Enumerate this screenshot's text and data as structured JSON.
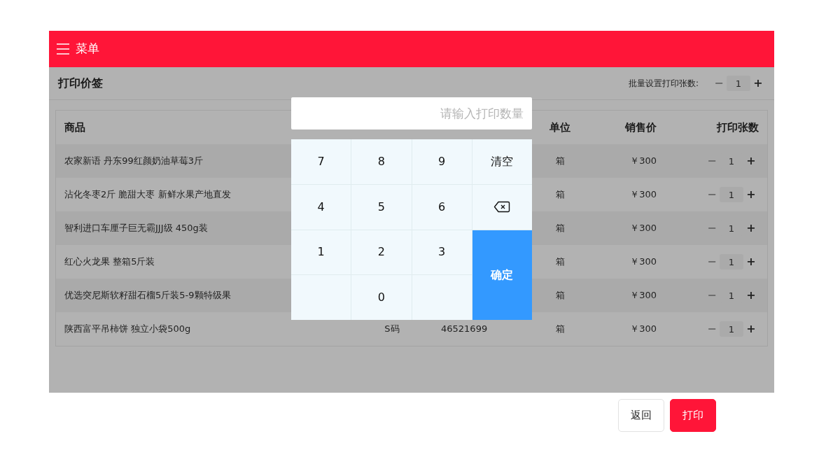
{
  "menu": {
    "label": "菜单"
  },
  "page_title": "打印价签",
  "batch": {
    "label": "批量设置打印张数:",
    "minus": "−",
    "value": "1",
    "plus": "+"
  },
  "table": {
    "columns": [
      {
        "kind": "name",
        "label": "商品"
      },
      {
        "kind": "unit",
        "label": "单位"
      },
      {
        "kind": "price",
        "label": "销售价"
      },
      {
        "kind": "qty",
        "label": "打印张数"
      }
    ],
    "rows": [
      {
        "name": "农家新语 丹东99红颜奶油草莓3斤",
        "unit": "箱",
        "price": "￥300",
        "minus": "−",
        "qty": "1",
        "plus": "+"
      },
      {
        "name": "沾化冬枣2斤 脆甜大枣 新鲜水果产地直发",
        "unit": "箱",
        "price": "￥300",
        "minus": "−",
        "qty": "1",
        "plus": "+"
      },
      {
        "name": "智利进口车厘子巨无霸JJJ级 450g装",
        "unit": "箱",
        "price": "￥300",
        "minus": "−",
        "qty": "1",
        "plus": "+"
      },
      {
        "name": "红心火龙果 整箱5斤装",
        "unit": "箱",
        "price": "￥300",
        "minus": "−",
        "qty": "1",
        "plus": "+"
      },
      {
        "name": "优选突尼斯软籽甜石榴5斤装5-9颗特级果",
        "unit": "箱",
        "price": "￥300",
        "minus": "−",
        "qty": "1",
        "plus": "+"
      },
      {
        "name": "陕西富平吊柿饼 独立小袋500g",
        "spec": "S码",
        "barcode": "46521699",
        "unit": "箱",
        "price": "￥300",
        "minus": "−",
        "qty": "1",
        "plus": "+"
      }
    ]
  },
  "keypad": {
    "placeholder": "请输入打印数量",
    "keys": [
      {
        "kind": "digit",
        "label": "7"
      },
      {
        "kind": "digit",
        "label": "8"
      },
      {
        "kind": "digit",
        "label": "9"
      },
      {
        "kind": "clear",
        "label": "清空"
      },
      {
        "kind": "digit",
        "label": "4"
      },
      {
        "kind": "digit",
        "label": "5"
      },
      {
        "kind": "digit",
        "label": "6"
      },
      {
        "kind": "backspace"
      },
      {
        "kind": "digit",
        "label": "1"
      },
      {
        "kind": "digit",
        "label": "2"
      },
      {
        "kind": "digit",
        "label": "3"
      },
      {
        "kind": "confirm",
        "label": "确定"
      },
      {
        "kind": "blank"
      },
      {
        "kind": "digit",
        "label": "0"
      },
      {
        "kind": "blank"
      }
    ]
  },
  "footer_buttons": [
    {
      "kind": "secondary",
      "label": "返回"
    },
    {
      "kind": "primary",
      "label": "打印"
    }
  ]
}
